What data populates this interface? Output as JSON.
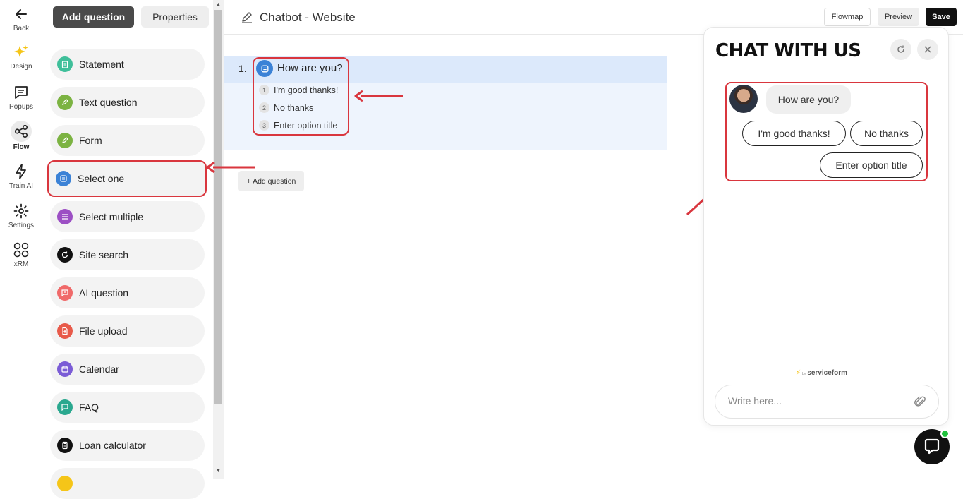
{
  "rail": {
    "back": "Back",
    "design": "Design",
    "popups": "Popups",
    "flow": "Flow",
    "train_ai": "Train AI",
    "settings": "Settings",
    "xrm": "xRM"
  },
  "panel": {
    "tab_add": "Add question",
    "tab_properties": "Properties",
    "items": [
      {
        "label": "Statement",
        "color": "#3fbf9a"
      },
      {
        "label": "Text question",
        "color": "#7cb342"
      },
      {
        "label": "Form",
        "color": "#7cb342"
      },
      {
        "label": "Select one",
        "color": "#3b82d6"
      },
      {
        "label": "Select multiple",
        "color": "#9c4fc4"
      },
      {
        "label": "Site search",
        "color": "#111111"
      },
      {
        "label": "AI question",
        "color": "#f06a6a"
      },
      {
        "label": "File upload",
        "color": "#e85a4a"
      },
      {
        "label": "Calendar",
        "color": "#7b5cd6"
      },
      {
        "label": "FAQ",
        "color": "#2aa88f"
      },
      {
        "label": "Loan calculator",
        "color": "#111111"
      }
    ]
  },
  "topbar": {
    "title": "Chatbot - Website",
    "flowmap": "Flowmap",
    "preview": "Preview",
    "save": "Save"
  },
  "flow": {
    "number": "1.",
    "question": "How are you?",
    "options": [
      {
        "n": "1",
        "label": "I'm good thanks!"
      },
      {
        "n": "2",
        "label": "No thanks"
      },
      {
        "n": "3",
        "label": "Enter option title"
      }
    ],
    "add_question": "+ Add question"
  },
  "chat": {
    "title": "CHAT WITH US",
    "bubble": "How are you?",
    "options": [
      "I'm good thanks!",
      "No thanks",
      "Enter option title"
    ],
    "powered_by": "by",
    "brand": "serviceform",
    "input_placeholder": "Write here..."
  },
  "colors": {
    "highlight": "#d9363e",
    "accent_dark": "#111111",
    "online": "#20c33d"
  }
}
